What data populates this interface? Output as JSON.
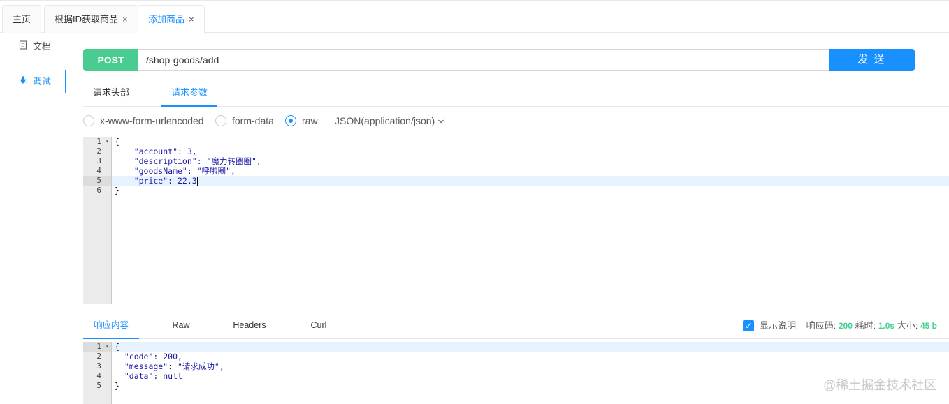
{
  "tabs": [
    {
      "label": "主页",
      "closable": false,
      "active": false
    },
    {
      "label": "根据ID获取商品",
      "closable": true,
      "active": false
    },
    {
      "label": "添加商品",
      "closable": true,
      "active": true
    }
  ],
  "close_glyph": "×",
  "sidebar": {
    "items": [
      {
        "label": "文档",
        "icon": "document-icon",
        "active": false
      },
      {
        "label": "调试",
        "icon": "bug-icon",
        "active": true
      }
    ]
  },
  "request": {
    "method": "POST",
    "url": "/shop-goods/add",
    "send_label": "发 送",
    "method_color": "#49cc90",
    "accent_color": "#1890ff"
  },
  "request_tabs": [
    {
      "label": "请求头部",
      "active": false
    },
    {
      "label": "请求参数",
      "active": true
    }
  ],
  "body_types": [
    {
      "label": "x-www-form-urlencoded",
      "selected": false
    },
    {
      "label": "form-data",
      "selected": false
    },
    {
      "label": "raw",
      "selected": true
    }
  ],
  "content_type": "JSON(application/json)",
  "request_body": {
    "line_numbers": [
      "1",
      "2",
      "3",
      "4",
      "5",
      "6"
    ],
    "current_line": 5,
    "lines": [
      "{",
      "    \"account\": 3,",
      "    \"description\": \"魔力转圈圈\",",
      "    \"goodsName\": \"呼啦圈\",",
      "    \"price\": 22.3",
      "}"
    ]
  },
  "response_tabs": [
    {
      "label": "响应内容",
      "active": true
    },
    {
      "label": "Raw",
      "active": false
    },
    {
      "label": "Headers",
      "active": false
    },
    {
      "label": "Curl",
      "active": false
    }
  ],
  "response_info": {
    "show_desc_label": "显示说明",
    "show_desc_checked": true,
    "status_label": "响应码:",
    "status_value": "200",
    "time_label": "耗时:",
    "time_value": "1.0s",
    "size_label": "大小:",
    "size_value": "45 b"
  },
  "response_body": {
    "line_numbers": [
      "1",
      "2",
      "3",
      "4",
      "5"
    ],
    "current_line": 1,
    "lines": [
      "{",
      "  \"code\": 200,",
      "  \"message\": \"请求成功\",",
      "  \"data\": null",
      "}"
    ]
  },
  "watermark": "@稀土掘金技术社区"
}
